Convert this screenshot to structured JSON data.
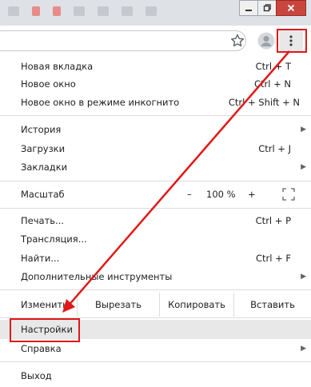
{
  "menu": {
    "new_tab": {
      "label": "Новая вкладка",
      "shortcut": "Ctrl + T"
    },
    "new_window": {
      "label": "Новое окно",
      "shortcut": "Ctrl + N"
    },
    "incognito": {
      "label": "Новое окно в режиме инкогнито",
      "shortcut": "Ctrl + Shift + N"
    },
    "history": {
      "label": "История"
    },
    "downloads": {
      "label": "Загрузки",
      "shortcut": "Ctrl + J"
    },
    "bookmarks": {
      "label": "Закладки"
    },
    "zoom": {
      "label": "Масштаб",
      "minus": "–",
      "value": "100 %",
      "plus": "+"
    },
    "print": {
      "label": "Печать...",
      "shortcut": "Ctrl + P"
    },
    "cast": {
      "label": "Трансляция..."
    },
    "find": {
      "label": "Найти...",
      "shortcut": "Ctrl + F"
    },
    "more_tools": {
      "label": "Дополнительные инструменты"
    },
    "edit": {
      "label": "Изменить",
      "cut": "Вырезать",
      "copy": "Копировать",
      "paste": "Вставить"
    },
    "settings": {
      "label": "Настройки"
    },
    "help": {
      "label": "Справка"
    },
    "exit": {
      "label": "Выход"
    }
  },
  "colors": {
    "highlight": "#e01818",
    "accent": "#dee1e6"
  },
  "icons": [
    "minimize-icon",
    "restore-icon",
    "close-icon",
    "star-icon",
    "avatar-icon",
    "kebab-menu-icon",
    "fullscreen-icon",
    "chevron-right-icon"
  ]
}
